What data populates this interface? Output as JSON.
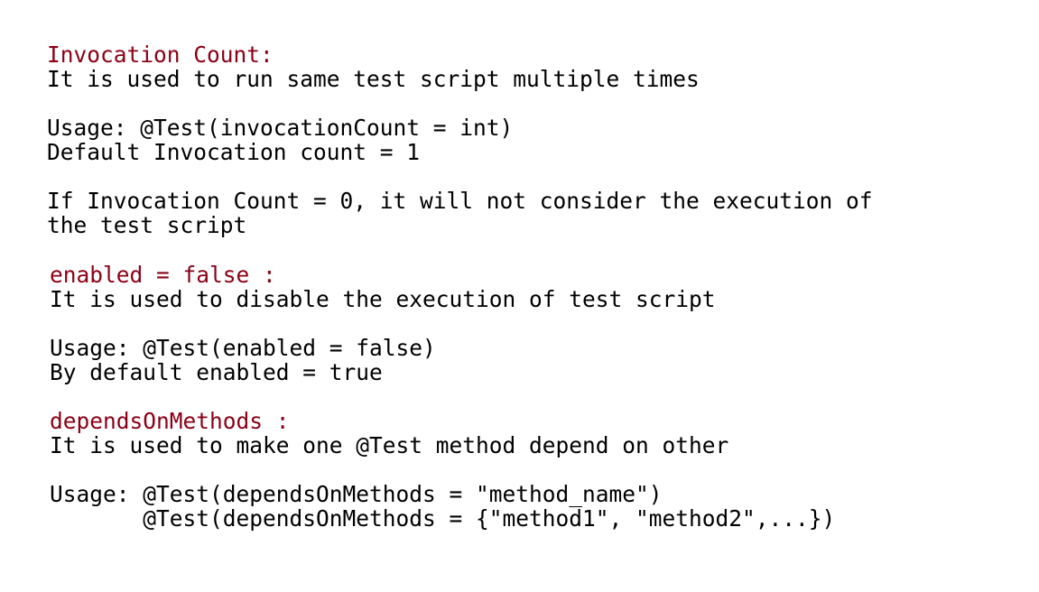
{
  "sections": [
    {
      "heading": "Invocation Count:",
      "description": "It is used to run same test script multiple times",
      "usage_line_1": "Usage: @Test(invocationCount = int)",
      "usage_line_2": "Default Invocation count = 1",
      "note_line_1": "If Invocation Count = 0, it will not consider the execution of",
      "note_line_2": "the test script"
    },
    {
      "heading": "enabled = false :",
      "description": "It is used to disable the execution of test script",
      "usage_line_1": "Usage: @Test(enabled = false)",
      "usage_line_2": "By default enabled = true"
    },
    {
      "heading": "dependsOnMethods :",
      "description": "It is used to make one @Test method depend on other",
      "usage_line_1": "Usage: @Test(dependsOnMethods = \"method_name\")",
      "usage_line_2": "       @Test(dependsOnMethods = {\"method1\", \"method2\",...})"
    }
  ],
  "colors": {
    "heading": "#8b0016",
    "body_text": "#000000",
    "background": "#ffffff"
  }
}
